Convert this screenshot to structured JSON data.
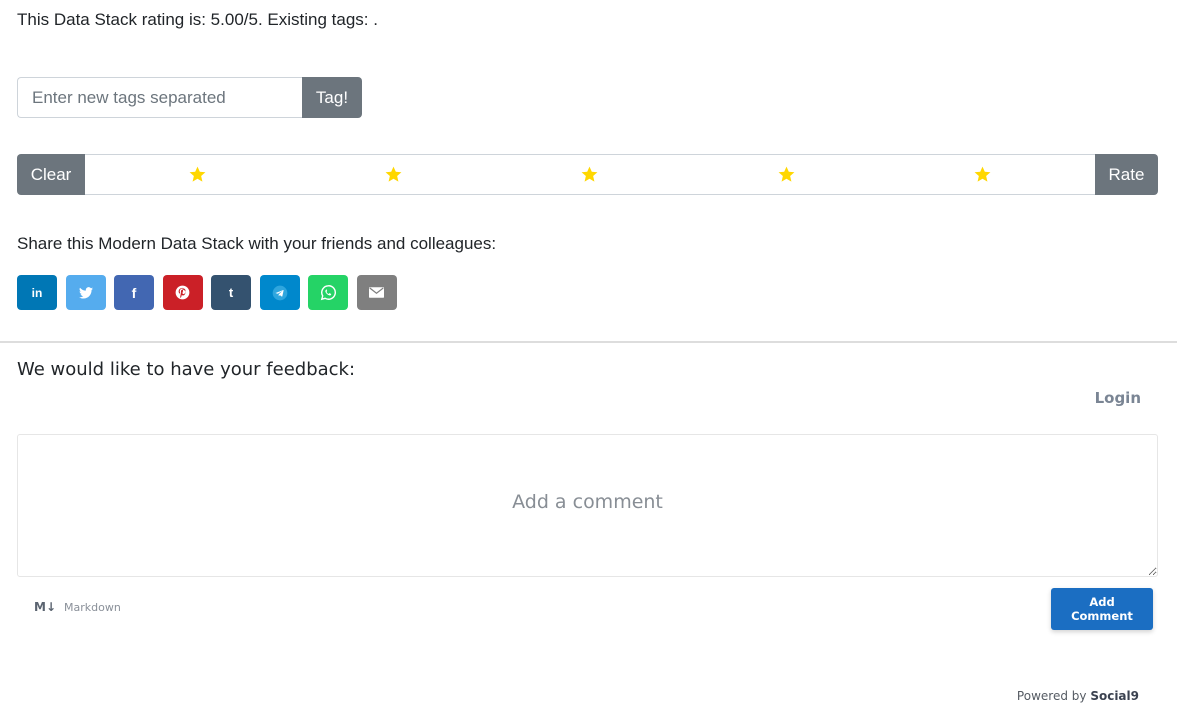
{
  "rating": {
    "text": "This Data Stack rating is: 5.00/5. Existing tags: .",
    "value": 5.0,
    "max": 5
  },
  "tags": {
    "input_placeholder": "Enter new tags separated",
    "input_value": "",
    "submit_label": "Tag!"
  },
  "rate_widget": {
    "clear_label": "Clear",
    "rate_label": "Rate",
    "star_count": 5,
    "filled_stars": 5,
    "star_color": "#ffd700"
  },
  "share": {
    "text": "Share this Modern Data Stack with your friends and colleagues:",
    "buttons": [
      {
        "name": "linkedin",
        "icon": "linkedin-icon",
        "glyph": "in",
        "color": "#0077b5"
      },
      {
        "name": "twitter",
        "icon": "twitter-icon",
        "glyph": "",
        "color": "#55acee"
      },
      {
        "name": "facebook",
        "icon": "facebook-icon",
        "glyph": "f",
        "color": "#4267b2"
      },
      {
        "name": "pinterest",
        "icon": "pinterest-icon",
        "glyph": "",
        "color": "#cb2027"
      },
      {
        "name": "tumblr",
        "icon": "tumblr-icon",
        "glyph": "t",
        "color": "#34526f"
      },
      {
        "name": "telegram",
        "icon": "telegram-icon",
        "glyph": "",
        "color": "#0088cc"
      },
      {
        "name": "whatsapp",
        "icon": "whatsapp-icon",
        "glyph": "",
        "color": "#25d366"
      },
      {
        "name": "email",
        "icon": "email-icon",
        "glyph": "",
        "color": "#7f7f7f"
      }
    ]
  },
  "feedback": {
    "title": "We would like to have your feedback:",
    "login_label": "Login",
    "comment_placeholder": "Add a comment",
    "comment_value": "",
    "markdown_icon": "M↓",
    "markdown_label": "Markdown",
    "add_comment_label": "Add Comment",
    "accent_color": "#1b6ec2"
  },
  "footer": {
    "powered_prefix": "Powered by",
    "powered_brand": "Social9"
  }
}
